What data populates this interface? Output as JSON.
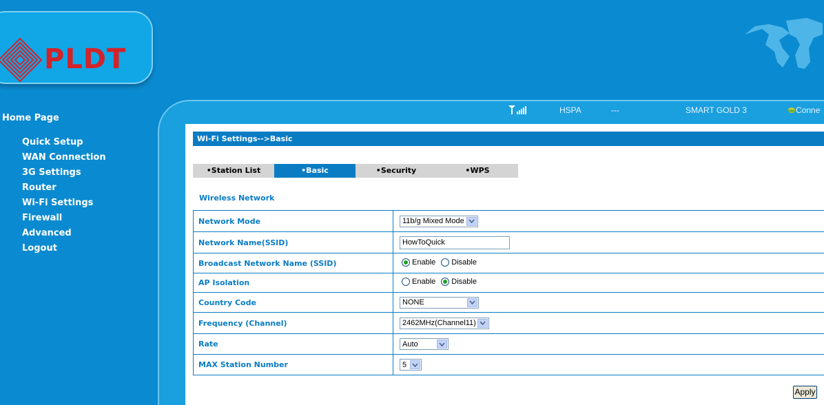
{
  "brand": {
    "name": "PLDT"
  },
  "nav": {
    "home": "Home Page",
    "items": [
      "Quick Setup",
      "WAN Connection",
      "3G Settings",
      "Router",
      "Wi-Fi Settings",
      "Firewall",
      "Advanced",
      "Logout"
    ]
  },
  "status": {
    "network_type": "HSPA",
    "dashes": "---",
    "operator": "SMART GOLD 3",
    "connection": "Conne"
  },
  "page": {
    "breadcrumb": "Wi-Fi Settings-->Basic",
    "tabs": [
      "•Station List",
      "•Basic",
      "•Security",
      "•WPS"
    ],
    "active_tab": "•Basic",
    "section_title": "Wireless Network"
  },
  "form": {
    "network_mode": {
      "label": "Network Mode",
      "value": "11b/g Mixed Mode"
    },
    "ssid": {
      "label": "Network Name(SSID)",
      "value": "HowToQuick"
    },
    "broadcast": {
      "label": "Broadcast Network Name (SSID)",
      "enable": "Enable",
      "disable": "Disable",
      "selected": "Enable"
    },
    "ap_isolation": {
      "label": "AP Isolation",
      "enable": "Enable",
      "disable": "Disable",
      "selected": "Disable"
    },
    "country_code": {
      "label": "Country Code",
      "value": "NONE"
    },
    "frequency": {
      "label": "Frequency (Channel)",
      "value": "2462MHz(Channel11)"
    },
    "rate": {
      "label": "Rate",
      "value": "Auto"
    },
    "max_station": {
      "label": "MAX Station Number",
      "value": "5"
    },
    "apply_label": "Apply"
  },
  "colors": {
    "background": "#0a8ad0",
    "accent": "#0a7cc4",
    "brand_red": "#d2232a"
  },
  "icons": [
    "pldt-logo-icon",
    "world-map-icon",
    "signal-icon",
    "connection-globe-icon",
    "chevron-down-icon"
  ]
}
